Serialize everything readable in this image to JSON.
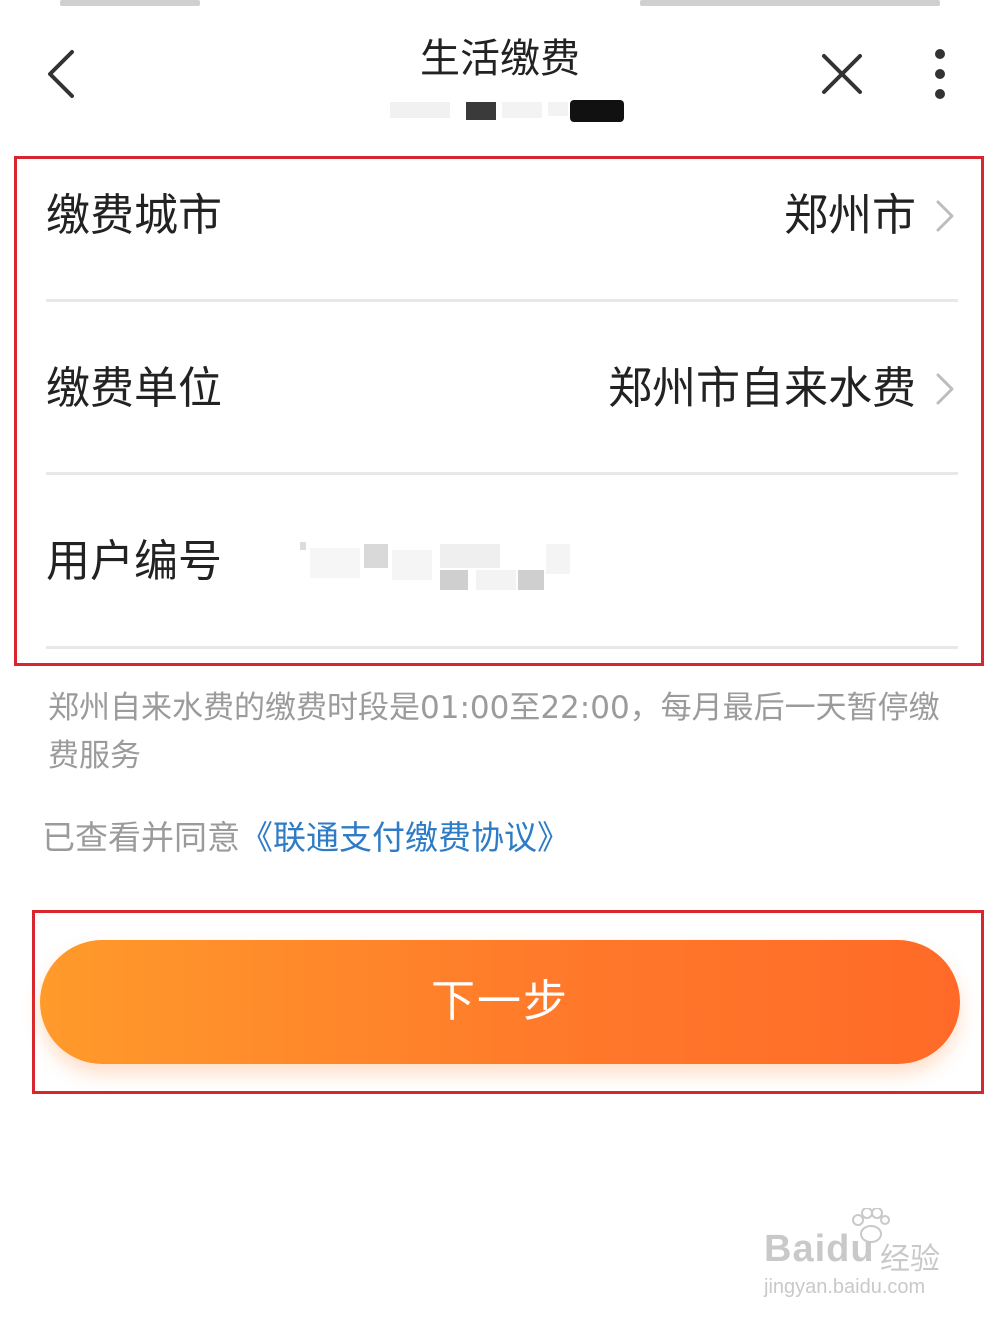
{
  "header": {
    "title": "生活缴费",
    "back_icon": "chevron-left-icon",
    "close_icon": "close-icon",
    "more_icon": "more-vertical-icon"
  },
  "form": {
    "rows": [
      {
        "label": "缴费城市",
        "value": "郑州市",
        "icon": "chevron-right-icon"
      },
      {
        "label": "缴费单位",
        "value": "郑州市自来水费",
        "icon": "chevron-right-icon"
      },
      {
        "label": "用户编号",
        "value": ""
      }
    ]
  },
  "notice": "郑州自来水费的缴费时段是01:00至22:00，每月最后一天暂停缴费服务",
  "agreement": {
    "prefix": "已查看并同意",
    "link": "《联通支付缴费协议》"
  },
  "next_button": {
    "label": "下一步"
  },
  "watermark": {
    "logo": "Baidu",
    "product": "经验",
    "url": "jingyan.baidu.com"
  },
  "colors": {
    "accent": "#ff7a2a",
    "highlight_border": "#d7262d",
    "link": "#2f7cc6",
    "muted_text": "#9b9b9b"
  }
}
